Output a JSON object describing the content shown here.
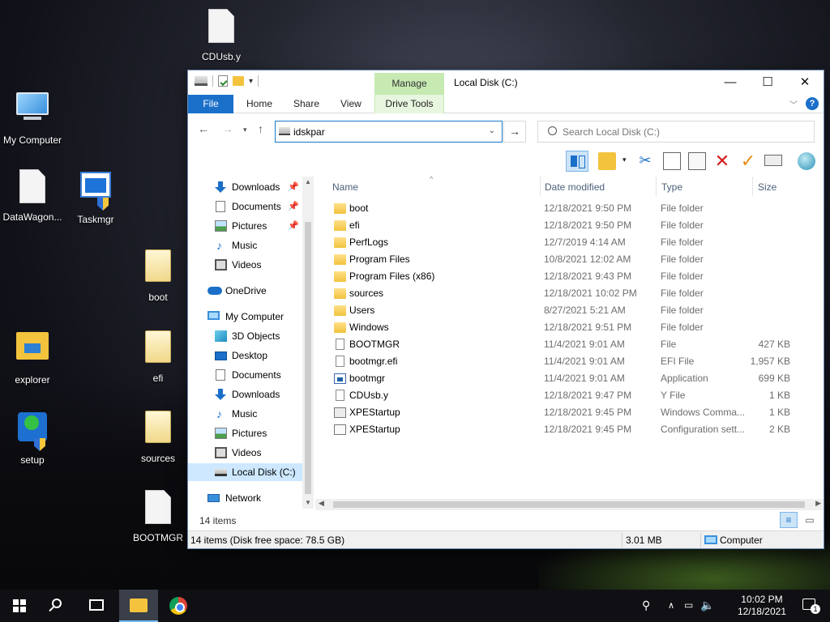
{
  "desktop": {
    "icons": [
      {
        "label": "CDUsb.y",
        "icon": "file-icon"
      },
      {
        "label": "My Computer",
        "icon": "computer-icon"
      },
      {
        "label": "DataWagon...",
        "icon": "shortcut-file-icon"
      },
      {
        "label": "Taskmgr",
        "icon": "taskmgr-icon"
      },
      {
        "label": "boot",
        "icon": "folder-icon"
      },
      {
        "label": "explorer",
        "icon": "explorer-icon"
      },
      {
        "label": "efi",
        "icon": "folder-icon"
      },
      {
        "label": "setup",
        "icon": "setup-icon"
      },
      {
        "label": "sources",
        "icon": "folder-icon"
      },
      {
        "label": "BOOTMGR",
        "icon": "file-icon"
      }
    ]
  },
  "window": {
    "title": "Local Disk (C:)",
    "manage_label": "Manage",
    "tabs": {
      "file": "File",
      "home": "Home",
      "share": "Share",
      "view": "View",
      "drive_tools": "Drive Tools"
    },
    "address_value": "idskpar",
    "search_placeholder": "Search Local Disk (C:)",
    "controls": {
      "minimize": "—",
      "maximize": "☐",
      "close": "✕"
    }
  },
  "nav": {
    "items": [
      {
        "label": "Downloads",
        "pinned": true
      },
      {
        "label": "Documents",
        "pinned": true
      },
      {
        "label": "Pictures",
        "pinned": true
      },
      {
        "label": "Music",
        "pinned": false
      },
      {
        "label": "Videos",
        "pinned": false
      },
      {
        "label": "OneDrive",
        "pinned": false
      },
      {
        "label": "My Computer",
        "pinned": false
      },
      {
        "label": "3D Objects",
        "pinned": false
      },
      {
        "label": "Desktop",
        "pinned": false
      },
      {
        "label": "Documents",
        "pinned": false
      },
      {
        "label": "Downloads",
        "pinned": false
      },
      {
        "label": "Music",
        "pinned": false
      },
      {
        "label": "Pictures",
        "pinned": false
      },
      {
        "label": "Videos",
        "pinned": false
      },
      {
        "label": "Local Disk (C:)",
        "pinned": false
      },
      {
        "label": "Network",
        "pinned": false
      }
    ]
  },
  "files": {
    "columns": {
      "name": "Name",
      "date": "Date modified",
      "type": "Type",
      "size": "Size"
    },
    "rows": [
      {
        "name": "boot",
        "date": "12/18/2021 9:50 PM",
        "type": "File folder",
        "size": "",
        "icon": "folder-icon"
      },
      {
        "name": "efi",
        "date": "12/18/2021 9:50 PM",
        "type": "File folder",
        "size": "",
        "icon": "folder-icon"
      },
      {
        "name": "PerfLogs",
        "date": "12/7/2019 4:14 AM",
        "type": "File folder",
        "size": "",
        "icon": "folder-icon"
      },
      {
        "name": "Program Files",
        "date": "10/8/2021 12:02 AM",
        "type": "File folder",
        "size": "",
        "icon": "folder-icon"
      },
      {
        "name": "Program Files (x86)",
        "date": "12/18/2021 9:43 PM",
        "type": "File folder",
        "size": "",
        "icon": "folder-icon"
      },
      {
        "name": "sources",
        "date": "12/18/2021 10:02 PM",
        "type": "File folder",
        "size": "",
        "icon": "folder-icon"
      },
      {
        "name": "Users",
        "date": "8/27/2021 5:21 AM",
        "type": "File folder",
        "size": "",
        "icon": "folder-icon"
      },
      {
        "name": "Windows",
        "date": "12/18/2021 9:51 PM",
        "type": "File folder",
        "size": "",
        "icon": "folder-icon"
      },
      {
        "name": "BOOTMGR",
        "date": "11/4/2021 9:01 AM",
        "type": "File",
        "size": "427 KB",
        "icon": "file-icon"
      },
      {
        "name": "bootmgr.efi",
        "date": "11/4/2021 9:01 AM",
        "type": "EFI File",
        "size": "1,957 KB",
        "icon": "file-icon"
      },
      {
        "name": "bootmgr",
        "date": "11/4/2021 9:01 AM",
        "type": "Application",
        "size": "699 KB",
        "icon": "application-icon"
      },
      {
        "name": "CDUsb.y",
        "date": "12/18/2021 9:47 PM",
        "type": "Y File",
        "size": "1 KB",
        "icon": "file-icon"
      },
      {
        "name": "XPEStartup",
        "date": "12/18/2021 9:45 PM",
        "type": "Windows Comma...",
        "size": "1 KB",
        "icon": "command-script-icon"
      },
      {
        "name": "XPEStartup",
        "date": "12/18/2021 9:45 PM",
        "type": "Configuration sett...",
        "size": "2 KB",
        "icon": "config-file-icon"
      }
    ]
  },
  "items_count": "14 items",
  "status": {
    "left": "14 items (Disk free space: 78.5 GB)",
    "size": "3.01 MB",
    "location": "Computer"
  },
  "taskbar": {
    "time": "10:02 PM",
    "date": "12/18/2021",
    "notification_count": "1"
  }
}
